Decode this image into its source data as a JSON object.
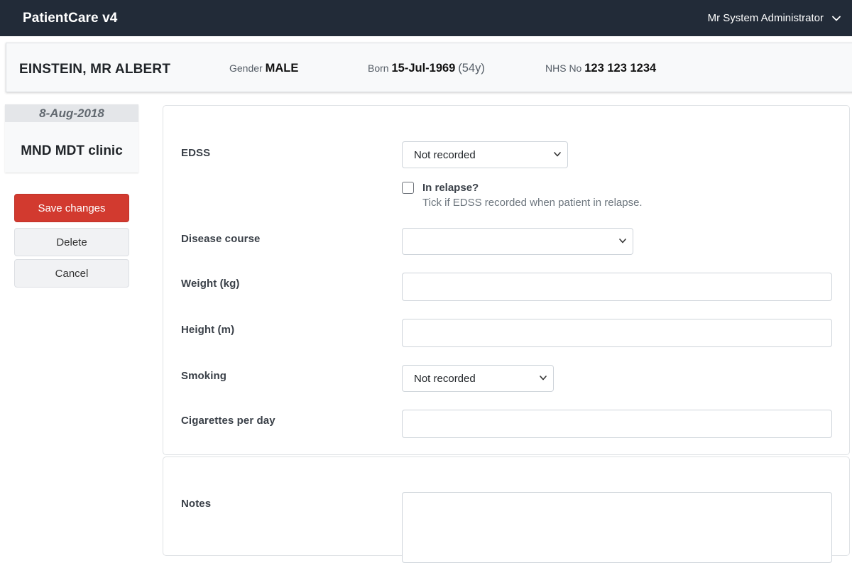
{
  "navbar": {
    "brand": "PatientCare v4",
    "user": "Mr System Administrator"
  },
  "patient": {
    "name": "EINSTEIN, MR ALBERT",
    "gender_label": "Gender",
    "gender": "MALE",
    "born_label": "Born",
    "born": "15-Jul-1969",
    "age": "(54y)",
    "nhs_label": "NHS No",
    "nhs": "123 123 1234"
  },
  "encounter": {
    "date": "8-Aug-2018",
    "title": "MND MDT clinic"
  },
  "actions": {
    "save": "Save changes",
    "delete": "Delete",
    "cancel": "Cancel"
  },
  "form": {
    "edss": {
      "label": "EDSS",
      "value": "Not recorded"
    },
    "relapse": {
      "label": "In relapse?",
      "help": "Tick if EDSS recorded when patient in relapse.",
      "checked": false
    },
    "disease_course": {
      "label": "Disease course",
      "value": ""
    },
    "weight": {
      "label": "Weight (kg)",
      "value": ""
    },
    "height": {
      "label": "Height (m)",
      "value": ""
    },
    "smoking": {
      "label": "Smoking",
      "value": "Not recorded"
    },
    "cigarettes": {
      "label": "Cigarettes per day",
      "value": ""
    },
    "notes": {
      "label": "Notes",
      "value": ""
    }
  },
  "icons": {
    "user_menu": "chevron-down-icon",
    "select": "chevron-down-icon"
  },
  "colors": {
    "navbar": "#222b38",
    "save_button": "#d23a2f"
  }
}
